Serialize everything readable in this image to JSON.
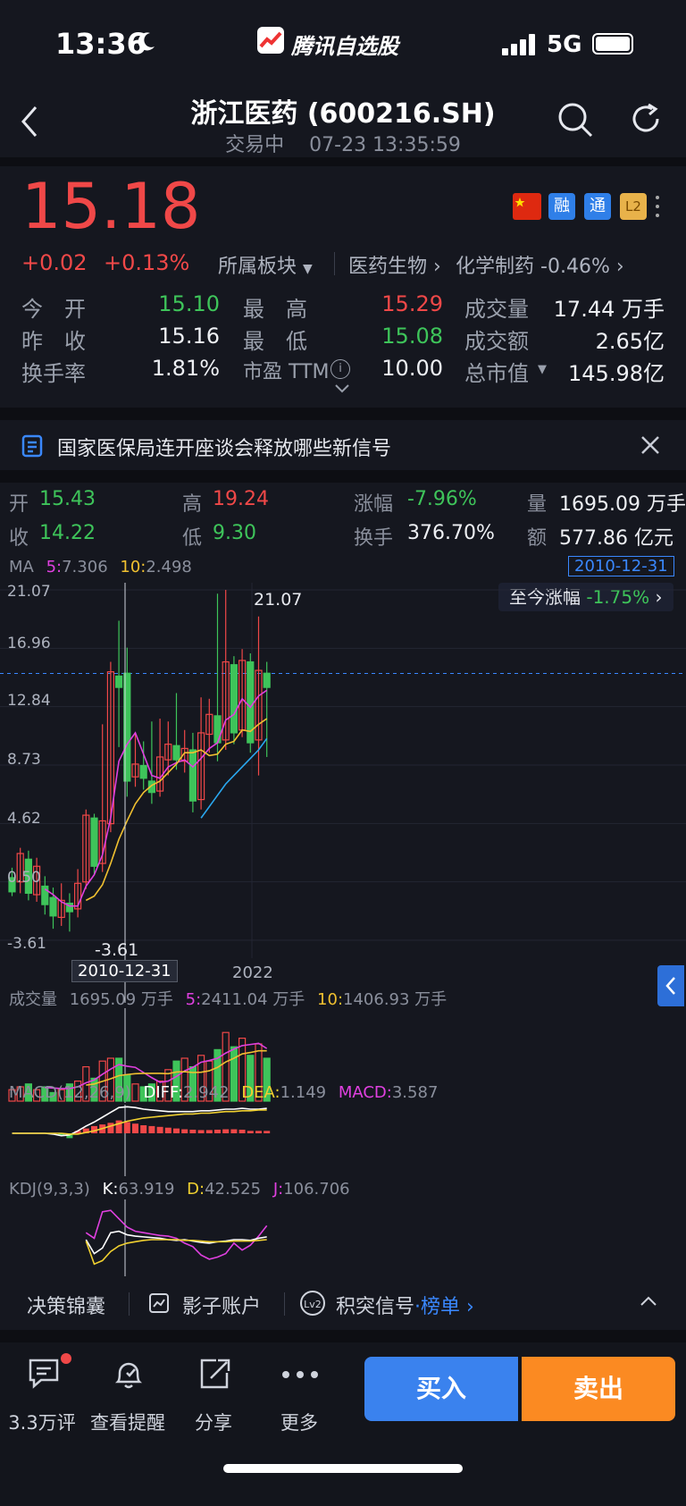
{
  "status_bar": {
    "time": "13:36",
    "app": "腾讯自选股",
    "network": "5G"
  },
  "header": {
    "title": "浙江医药 (600216.SH)",
    "status": "交易中",
    "datetime": "07-23 13:35:59"
  },
  "quote": {
    "price": "15.18",
    "change": "+0.02",
    "change_pct": "+0.13%",
    "sector_label": "所属板块",
    "sector1": "医药生物",
    "sector2": "化学制药",
    "sector2_pct": "-0.46%",
    "badges": [
      "融",
      "通",
      "L2"
    ],
    "rows": [
      {
        "l1": "今　开",
        "v1": "15.10",
        "l2": "最　高",
        "v2": "15.29",
        "l3": "成交量",
        "v3": "17.44 万手"
      },
      {
        "l1": "昨　收",
        "v1": "15.16",
        "l2": "最　低",
        "v2": "15.08",
        "l3": "成交额",
        "v3": "2.65亿"
      },
      {
        "l1": "换手率",
        "v1": "1.81%",
        "l2": "市盈 TTM",
        "v2": "10.00",
        "l3": "总市值",
        "v3": "145.98亿"
      }
    ]
  },
  "news": {
    "text": "国家医保局连开座谈会释放哪些新信号"
  },
  "kline_info": {
    "open_l": "开",
    "open": "15.43",
    "high_l": "高",
    "high": "19.24",
    "chg_l": "涨幅",
    "chg": "-7.96%",
    "vol_l": "量",
    "vol": "1695.09 万手",
    "close_l": "收",
    "close": "14.22",
    "low_l": "低",
    "low": "9.30",
    "turn_l": "换手",
    "turn": "376.70%",
    "amt_l": "额",
    "amt": "577.86 亿元"
  },
  "ma": {
    "label": "MA",
    "ma5_l": "5:",
    "ma5": "7.306",
    "ma10_l": "10:",
    "ma10": "2.498",
    "date": "2010-12-31"
  },
  "since": {
    "label": "至今涨幅",
    "value": "-1.75%"
  },
  "yaxis": [
    "21.07",
    "16.96",
    "12.84",
    "8.73",
    "4.62",
    "0.50",
    "-3.61"
  ],
  "max_label": "21.07",
  "min_label": "-3.61",
  "xaxis": {
    "cursor_date": "2010-12-31",
    "year": "2022"
  },
  "volume": {
    "label": "成交量",
    "value": "1695.09 万手",
    "ma5_l": "5:",
    "ma5": "2411.04 万手",
    "ma10_l": "10:",
    "ma10": "1406.93 万手"
  },
  "macd": {
    "label": "MACD(12,26,9)",
    "diff_l": "DIFF:",
    "diff": "2.942",
    "dea_l": "DEA:",
    "dea": "1.149",
    "macd_l": "MACD:",
    "macd": "3.587"
  },
  "kdj": {
    "label": "KDJ(9,3,3)",
    "k_l": "K:",
    "k": "63.919",
    "d_l": "D:",
    "d": "42.525",
    "j_l": "J:",
    "j": "106.706"
  },
  "tools": {
    "t1": "决策锦囊",
    "t2": "影子账户",
    "t3": "积突信号",
    "t3b": "·",
    "t4": "榜单"
  },
  "tabbar": {
    "comments": "3.3万评",
    "alert": "查看提醒",
    "share": "分享",
    "more": "更多",
    "buy": "买入",
    "sell": "卖出"
  },
  "colors": {
    "up": "#f04848",
    "down": "#3ec45a",
    "accent": "#3a88ff",
    "sell": "#fb8a22"
  },
  "chart_data": {
    "type": "candlestick",
    "ylim": [
      -3.61,
      21.07
    ],
    "candles": [
      {
        "o": 0.8,
        "c": -0.2,
        "h": 1.5,
        "l": -0.5
      },
      {
        "o": 0.5,
        "c": 2.5,
        "h": 2.9,
        "l": -0.3
      },
      {
        "o": 2.1,
        "c": -0.3,
        "h": 2.7,
        "l": -0.8
      },
      {
        "o": -0.4,
        "c": 1.6,
        "h": 2.2,
        "l": -0.9
      },
      {
        "o": 0.2,
        "c": -1.1,
        "h": 0.9,
        "l": -1.8
      },
      {
        "o": -0.6,
        "c": -1.9,
        "h": 0.1,
        "l": -2.8
      },
      {
        "o": -2.0,
        "c": -0.8,
        "h": 0.4,
        "l": -2.6
      },
      {
        "o": -1.0,
        "c": -1.6,
        "h": -0.3,
        "l": -3.0
      },
      {
        "o": -1.4,
        "c": 0.4,
        "h": 1.4,
        "l": -2.0
      },
      {
        "o": 0.5,
        "c": 5.2,
        "h": 5.6,
        "l": 0.0
      },
      {
        "o": 5.0,
        "c": 1.6,
        "h": 5.3,
        "l": 1.0
      },
      {
        "o": 1.8,
        "c": 4.8,
        "h": 11.6,
        "l": 1.2
      },
      {
        "o": 4.6,
        "c": 15.3,
        "h": 16.0,
        "l": 4.0
      },
      {
        "o": 15.0,
        "c": 14.2,
        "h": 18.9,
        "l": 10.0
      },
      {
        "o": 15.2,
        "c": 7.6,
        "h": 17.0,
        "l": 6.5
      },
      {
        "o": 7.9,
        "c": 8.8,
        "h": 11.0,
        "l": 7.2
      },
      {
        "o": 8.7,
        "c": 7.8,
        "h": 10.4,
        "l": 7.0
      },
      {
        "o": 7.6,
        "c": 6.8,
        "h": 11.8,
        "l": 6.0
      },
      {
        "o": 6.9,
        "c": 9.3,
        "h": 12.0,
        "l": 6.5
      },
      {
        "o": 9.1,
        "c": 10.2,
        "h": 11.8,
        "l": 8.0
      },
      {
        "o": 10.1,
        "c": 9.1,
        "h": 13.8,
        "l": 8.4
      },
      {
        "o": 9.0,
        "c": 9.9,
        "h": 11.2,
        "l": 8.2
      },
      {
        "o": 9.8,
        "c": 6.2,
        "h": 11.0,
        "l": 5.4
      },
      {
        "o": 6.3,
        "c": 11.0,
        "h": 13.5,
        "l": 5.6
      },
      {
        "o": 10.9,
        "c": 12.3,
        "h": 13.4,
        "l": 9.6
      },
      {
        "o": 12.2,
        "c": 10.3,
        "h": 20.8,
        "l": 9.0
      },
      {
        "o": 10.5,
        "c": 16.0,
        "h": 21.07,
        "l": 9.8
      },
      {
        "o": 15.8,
        "c": 11.0,
        "h": 16.4,
        "l": 10.2
      },
      {
        "o": 11.2,
        "c": 16.1,
        "h": 16.9,
        "l": 10.7
      },
      {
        "o": 16.0,
        "c": 10.3,
        "h": 16.6,
        "l": 9.6
      },
      {
        "o": 10.5,
        "c": 15.4,
        "h": 19.2,
        "l": 8.0
      },
      {
        "o": 15.2,
        "c": 14.2,
        "h": 16.0,
        "l": 9.3
      }
    ],
    "ma5": [
      null,
      null,
      null,
      null,
      0.0,
      -0.4,
      -0.9,
      -1.2,
      -1.2,
      0.2,
      1.0,
      2.4,
      5.0,
      9.0,
      10.2,
      11.0,
      9.5,
      8.0,
      7.8,
      8.6,
      8.9,
      9.1,
      8.6,
      9.2,
      9.9,
      10.3,
      11.9,
      12.3,
      13.4,
      12.8,
      13.6,
      14.0
    ],
    "ma10": [
      null,
      null,
      null,
      null,
      null,
      null,
      null,
      null,
      null,
      -0.8,
      -0.5,
      0.3,
      1.8,
      3.5,
      4.8,
      6.0,
      6.8,
      7.3,
      7.6,
      8.2,
      8.8,
      9.6,
      9.6,
      9.8,
      9.4,
      9.5,
      10.2,
      10.4,
      11.2,
      11.1,
      11.6,
      12.0
    ],
    "ma20": [
      null,
      null,
      null,
      null,
      null,
      null,
      null,
      null,
      null,
      null,
      null,
      null,
      null,
      null,
      null,
      null,
      null,
      null,
      null,
      null,
      null,
      null,
      null,
      5.0,
      5.8,
      6.6,
      7.4,
      8.0,
      8.6,
      9.2,
      9.8,
      10.6
    ],
    "volume": [
      0.4,
      0.5,
      0.6,
      0.4,
      0.5,
      0.3,
      0.4,
      0.6,
      0.7,
      1.2,
      0.8,
      1.4,
      1.5,
      1.5,
      0.9,
      0.6,
      0.5,
      0.6,
      0.7,
      1.1,
      1.4,
      1.5,
      1.2,
      1.6,
      1.4,
      1.8,
      2.4,
      1.9,
      2.2,
      1.6,
      2.0,
      1.5
    ],
    "volume_up": [
      true,
      true,
      false,
      true,
      false,
      false,
      true,
      false,
      true,
      true,
      false,
      true,
      true,
      false,
      false,
      true,
      false,
      false,
      true,
      true,
      false,
      true,
      false,
      true,
      true,
      false,
      true,
      false,
      true,
      false,
      true,
      false
    ],
    "vol_max": 2.5,
    "macd_hist": [
      0,
      0,
      0,
      0,
      0,
      0,
      -0.3,
      -0.6,
      0.3,
      0.6,
      0.9,
      1.1,
      1.3,
      1.6,
      1.4,
      1.2,
      1.0,
      0.9,
      0.8,
      0.7,
      0.6,
      0.5,
      0.45,
      0.4,
      0.4,
      0.45,
      0.5,
      0.5,
      0.45,
      0.3,
      0.3,
      0.3
    ],
    "macd_diff": [
      0,
      0,
      0,
      0,
      0,
      -0.1,
      -0.3,
      -0.2,
      0.3,
      0.9,
      1.4,
      2.0,
      2.6,
      3.2,
      3.3,
      3.2,
      3.0,
      2.9,
      2.8,
      2.7,
      2.7,
      2.7,
      2.7,
      2.8,
      2.8,
      2.9,
      3.0,
      3.0,
      3.1,
      3.0,
      3.0,
      3.1
    ],
    "macd_dea": [
      0,
      0,
      0,
      0,
      0,
      0,
      0,
      -0.1,
      -0.1,
      0.1,
      0.3,
      0.6,
      0.9,
      1.2,
      1.5,
      1.7,
      1.9,
      2.0,
      2.1,
      2.2,
      2.3,
      2.4,
      2.4,
      2.5,
      2.5,
      2.6,
      2.7,
      2.7,
      2.8,
      2.8,
      2.9,
      2.9
    ],
    "kdj_k": [
      null,
      null,
      null,
      null,
      null,
      null,
      null,
      null,
      null,
      50,
      30,
      38,
      60,
      62,
      57,
      55,
      54,
      53,
      52,
      50,
      49,
      50,
      48,
      46,
      45,
      47,
      48,
      50,
      50,
      49,
      52,
      54
    ],
    "kdj_d": [
      null,
      null,
      null,
      null,
      null,
      null,
      null,
      null,
      null,
      48,
      15,
      20,
      33,
      41,
      45,
      47,
      49,
      50,
      50,
      50,
      50,
      49,
      49,
      48,
      47,
      47,
      47,
      48,
      48,
      48,
      49,
      50
    ],
    "kdj_j": [
      null,
      null,
      null,
      null,
      null,
      null,
      null,
      null,
      null,
      60,
      52,
      90,
      92,
      80,
      68,
      62,
      60,
      58,
      56,
      55,
      52,
      45,
      40,
      28,
      22,
      25,
      30,
      45,
      35,
      42,
      55,
      70
    ]
  }
}
